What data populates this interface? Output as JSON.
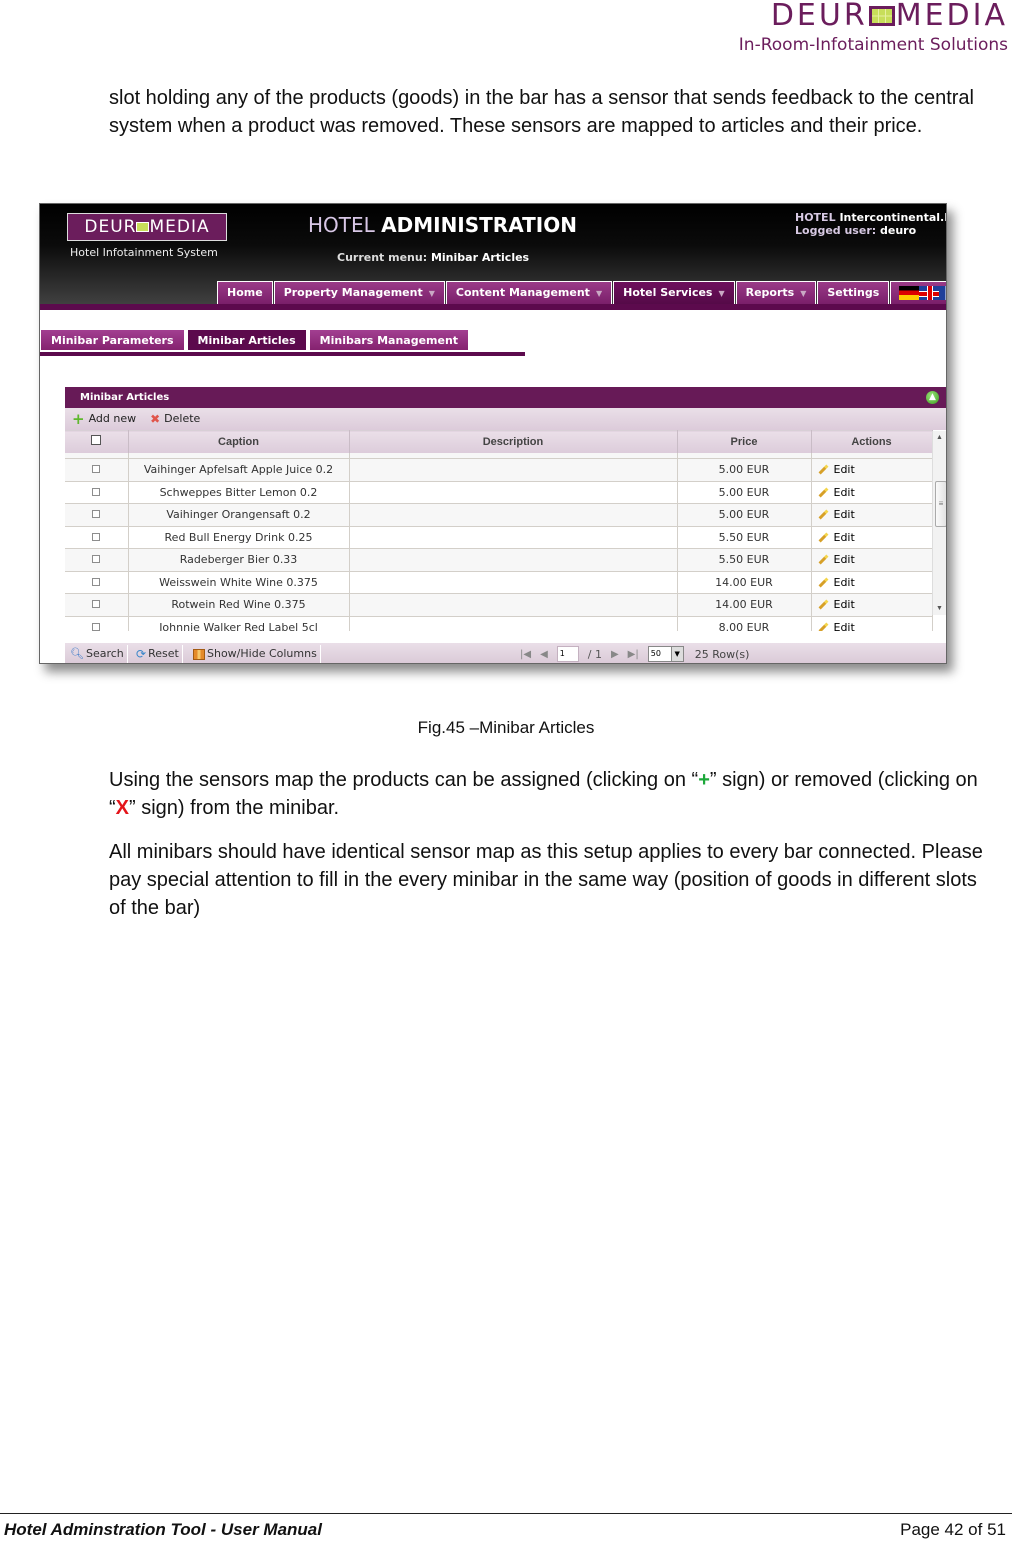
{
  "brand": {
    "logo_left": "DEUR",
    "logo_right": "MEDIA",
    "tagline": "In-Room-Infotainment Solutions",
    "color": "#6b1d5c"
  },
  "paragraph1": "slot holding any of the products (goods) in the bar has a sensor that sends feedback to the central system when a product was removed. These sensors are mapped to articles and their price.",
  "app": {
    "logo_left": "DEUR",
    "logo_right": "MEDIA",
    "subtitle": "Hotel Infotainment System",
    "title_light": "HOTEL",
    "title_bold": "ADMINISTRATION",
    "current_menu_label": "Current menu:",
    "current_menu_value": "Minibar Articles",
    "hotel_label": "HOTEL",
    "hotel_value": "Intercontinental.B",
    "user_label": "Logged user:",
    "user_value": "deuro",
    "nav": [
      {
        "label": "Home",
        "dropdown": false,
        "active": false
      },
      {
        "label": "Property Management",
        "dropdown": true,
        "active": false
      },
      {
        "label": "Content Management",
        "dropdown": true,
        "active": false
      },
      {
        "label": "Hotel Services",
        "dropdown": true,
        "active": true
      },
      {
        "label": "Reports",
        "dropdown": true,
        "active": false
      },
      {
        "label": "Settings",
        "dropdown": false,
        "active": false
      }
    ],
    "languages": [
      "German",
      "English",
      "French"
    ],
    "subtabs": [
      {
        "label": "Minibar Parameters",
        "active": false
      },
      {
        "label": "Minibar Articles",
        "active": true
      },
      {
        "label": "Minibars Management",
        "active": false
      }
    ],
    "grid": {
      "title": "Minibar Articles",
      "add_label": "Add new",
      "delete_label": "Delete",
      "columns": [
        "Caption",
        "Description",
        "Price",
        "Actions"
      ],
      "rows": [
        {
          "caption": "Vaihinger Apfelsaft Apple Juice 0.2",
          "description": "",
          "price": "5.00 EUR",
          "action": "Edit"
        },
        {
          "caption": "Schweppes Bitter Lemon 0.2",
          "description": "",
          "price": "5.00 EUR",
          "action": "Edit"
        },
        {
          "caption": "Vaihinger Orangensaft 0.2",
          "description": "",
          "price": "5.00 EUR",
          "action": "Edit"
        },
        {
          "caption": "Red Bull Energy Drink 0.25",
          "description": "",
          "price": "5.50 EUR",
          "action": "Edit"
        },
        {
          "caption": "Radeberger Bier 0.33",
          "description": "",
          "price": "5.50 EUR",
          "action": "Edit"
        },
        {
          "caption": "Weisswein White Wine 0.375",
          "description": "",
          "price": "14.00 EUR",
          "action": "Edit"
        },
        {
          "caption": "Rotwein Red Wine 0.375",
          "description": "",
          "price": "14.00 EUR",
          "action": "Edit"
        },
        {
          "caption": "Johnnie Walker Red Label 5cl",
          "description": "",
          "price": "8.00 EUR",
          "action": "Edit"
        }
      ],
      "footer": {
        "search_label": "Search",
        "reset_label": "Reset",
        "columns_label": "Show/Hide Columns",
        "page_value": "1",
        "page_total": "/ 1",
        "page_size": "50",
        "rows_count": "25 Row(s)"
      }
    }
  },
  "figure_caption": "Fig.45 –Minibar Articles",
  "paragraph2": {
    "part1": "Using the sensors map the products can be assigned (clicking on “",
    "plus": "+",
    "part2": "” sign) or removed (clicking on “",
    "x": "X",
    "part3": "” sign) from the minibar."
  },
  "paragraph3": "All minibars should have identical sensor map as this setup applies to every bar connected. Please pay special attention to fill in the every minibar in the same way (position of goods in different slots of the bar)",
  "footer": {
    "title": "Hotel Adminstration Tool - User Manual",
    "page": "Page 42 of 51"
  }
}
